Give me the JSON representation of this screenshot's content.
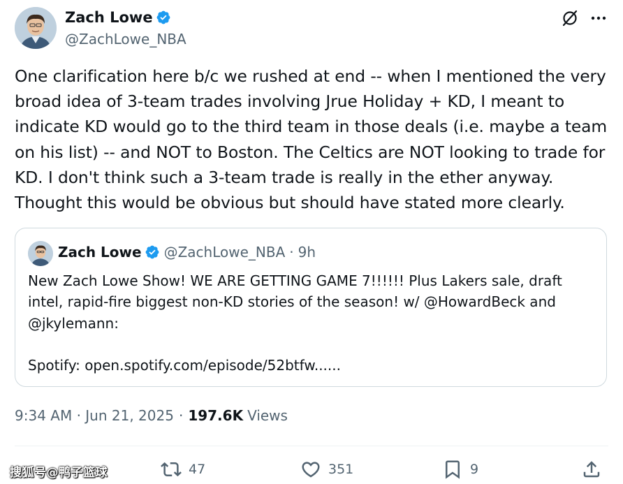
{
  "author": {
    "display_name": "Zach Lowe",
    "handle": "@ZachLowe_NBA",
    "avatar": "avatar-image",
    "verified_icon": "verified-badge-icon",
    "verified_color": "#1d9bf0"
  },
  "tweet": {
    "lines": [
      "One clarification here b/c we rushed at end -- when I mentioned the very",
      "broad idea of 3-team trades involving Jrue Holiday + KD, I meant to",
      "indicate KD would go to the third team in those deals (i.e. maybe a team",
      "on his list) -- and NOT to Boston. The Celtics are NOT looking to trade for",
      "KD. I don't think such a 3-team trade is really in the ether anyway.",
      "Thought this would be obvious but should have stated more clearly."
    ],
    "timestamp": "9:34 AM · Jun 21, 2025",
    "dot": "·",
    "views_count": "197.6K",
    "views_label": "Views"
  },
  "quoted": {
    "display_name": "Zach Lowe",
    "handle": "@ZachLowe_NBA",
    "dot": "·",
    "time": "9h",
    "lines": [
      "New Zach Lowe Show! WE ARE GETTING GAME 7!!!!!! Plus Lakers sale, draft",
      "intel, rapid-fire biggest non-KD stories of the season! w/ @HowardBeck and",
      "@jkylemann:",
      "",
      "Spotify: open.spotify.com/episode/52btfw......"
    ]
  },
  "actions": {
    "retweets": "47",
    "likes": "351",
    "bookmarks": "9"
  },
  "icons": {
    "grok": "grok-icon",
    "more": "more-icon",
    "reply": "reply-icon",
    "retweet": "retweet-icon",
    "like": "heart-icon",
    "bookmark": "bookmark-icon",
    "share": "share-icon"
  },
  "watermark": "搜狐号@鸭子篮球",
  "colors": {
    "text_primary": "#0f1419",
    "text_secondary": "#536471",
    "border": "#cfd9de"
  }
}
